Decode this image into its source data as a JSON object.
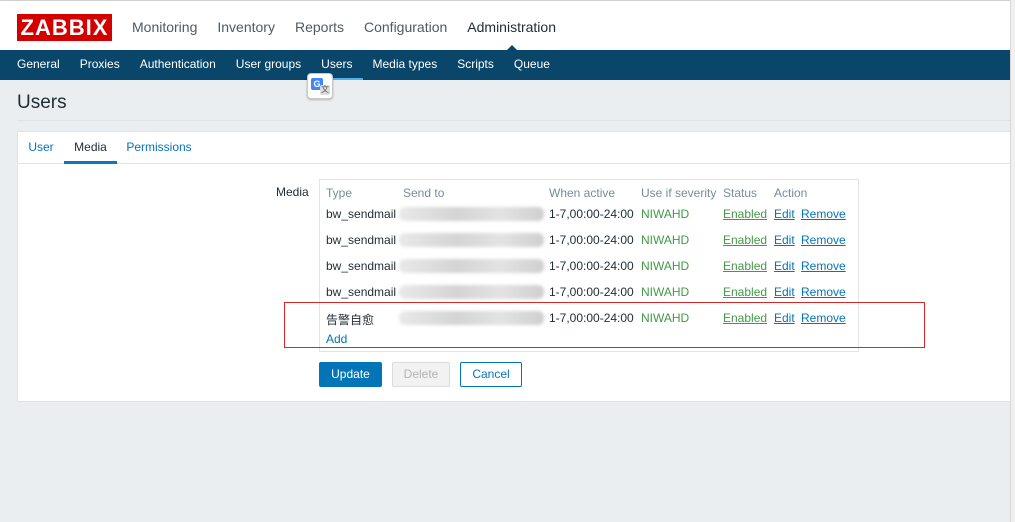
{
  "app": {
    "logo": "ZABBIX"
  },
  "top_nav": [
    {
      "label": "Monitoring"
    },
    {
      "label": "Inventory"
    },
    {
      "label": "Reports"
    },
    {
      "label": "Configuration"
    },
    {
      "label": "Administration",
      "active": true
    }
  ],
  "sub_nav": [
    {
      "label": "General"
    },
    {
      "label": "Proxies"
    },
    {
      "label": "Authentication"
    },
    {
      "label": "User groups"
    },
    {
      "label": "Users",
      "active": true
    },
    {
      "label": "Media types"
    },
    {
      "label": "Scripts"
    },
    {
      "label": "Queue"
    }
  ],
  "page": {
    "title": "Users"
  },
  "tabs": [
    {
      "label": "User"
    },
    {
      "label": "Media",
      "active": true
    },
    {
      "label": "Permissions"
    }
  ],
  "media": {
    "field_label": "Media",
    "headers": {
      "type": "Type",
      "send_to": "Send to",
      "when_active": "When active",
      "severity": "Use if severity",
      "status": "Status",
      "action": "Action"
    },
    "rows": [
      {
        "type": "bw_sendmail",
        "when_active": "1-7,00:00-24:00",
        "severity": "NIWAHD",
        "status": "Enabled",
        "edit": "Edit",
        "remove": "Remove"
      },
      {
        "type": "bw_sendmail",
        "when_active": "1-7,00:00-24:00",
        "severity": "NIWAHD",
        "status": "Enabled",
        "edit": "Edit",
        "remove": "Remove"
      },
      {
        "type": "bw_sendmail",
        "when_active": "1-7,00:00-24:00",
        "severity": "NIWAHD",
        "status": "Enabled",
        "edit": "Edit",
        "remove": "Remove"
      },
      {
        "type": "bw_sendmail",
        "when_active": "1-7,00:00-24:00",
        "severity": "NIWAHD",
        "status": "Enabled",
        "edit": "Edit",
        "remove": "Remove"
      },
      {
        "type": "告警自愈",
        "when_active": "1-7,00:00-24:00",
        "severity": "NIWAHD",
        "status": "Enabled",
        "edit": "Edit",
        "remove": "Remove"
      }
    ],
    "add_label": "Add"
  },
  "buttons": {
    "update": "Update",
    "delete": "Delete",
    "cancel": "Cancel"
  },
  "colors": {
    "brand": "#d40000",
    "nav_bg": "#0a466a",
    "link": "#0275b8",
    "enabled": "#429a46",
    "highlight": "#d62828"
  },
  "icons": {
    "translate": "google-translate-icon"
  }
}
